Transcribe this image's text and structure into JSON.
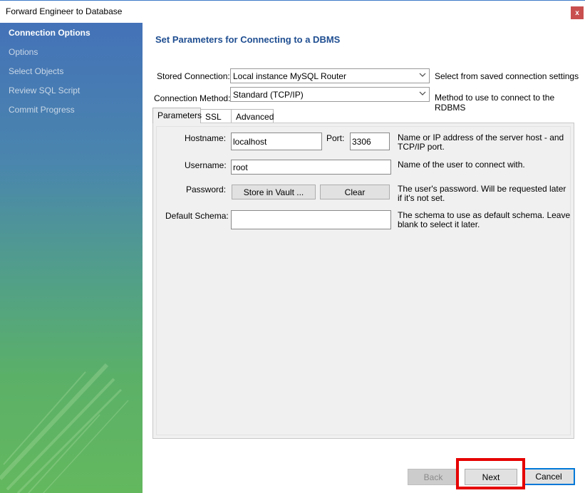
{
  "window": {
    "title": "Forward Engineer to Database",
    "close_label": "x"
  },
  "sidebar": {
    "items": [
      {
        "label": "Connection Options",
        "active": true
      },
      {
        "label": "Options",
        "active": false
      },
      {
        "label": "Select Objects",
        "active": false
      },
      {
        "label": "Review SQL Script",
        "active": false
      },
      {
        "label": "Commit Progress",
        "active": false
      }
    ]
  },
  "main": {
    "heading": "Set Parameters for Connecting to a DBMS",
    "stored_connection": {
      "label": "Stored Connection:",
      "value": "Local instance MySQL Router",
      "hint": "Select from saved connection settings"
    },
    "connection_method": {
      "label": "Connection Method:",
      "value": "Standard (TCP/IP)",
      "hint": "Method to use to connect to the RDBMS"
    },
    "tabs": [
      {
        "label": "Parameters",
        "active": true
      },
      {
        "label": "SSL",
        "active": false
      },
      {
        "label": "Advanced",
        "active": false
      }
    ],
    "params": {
      "hostname_label": "Hostname:",
      "hostname_value": "localhost",
      "port_label": "Port:",
      "port_value": "3306",
      "hostname_hint": "Name or IP address of the server host - and TCP/IP port.",
      "username_label": "Username:",
      "username_value": "root",
      "username_hint": "Name of the user to connect with.",
      "password_label": "Password:",
      "store_vault_label": "Store in Vault ...",
      "clear_label": "Clear",
      "password_hint": "The user's password. Will be requested later if it's not set.",
      "schema_label": "Default Schema:",
      "schema_value": "",
      "schema_hint": "The schema to use as default schema. Leave blank to select it later."
    }
  },
  "footer": {
    "back_label": "Back",
    "next_label": "Next",
    "cancel_label": "Cancel"
  },
  "colors": {
    "accent_heading": "#1f4e91",
    "highlight_box": "#e60000",
    "default_button_border": "#0078d7"
  }
}
